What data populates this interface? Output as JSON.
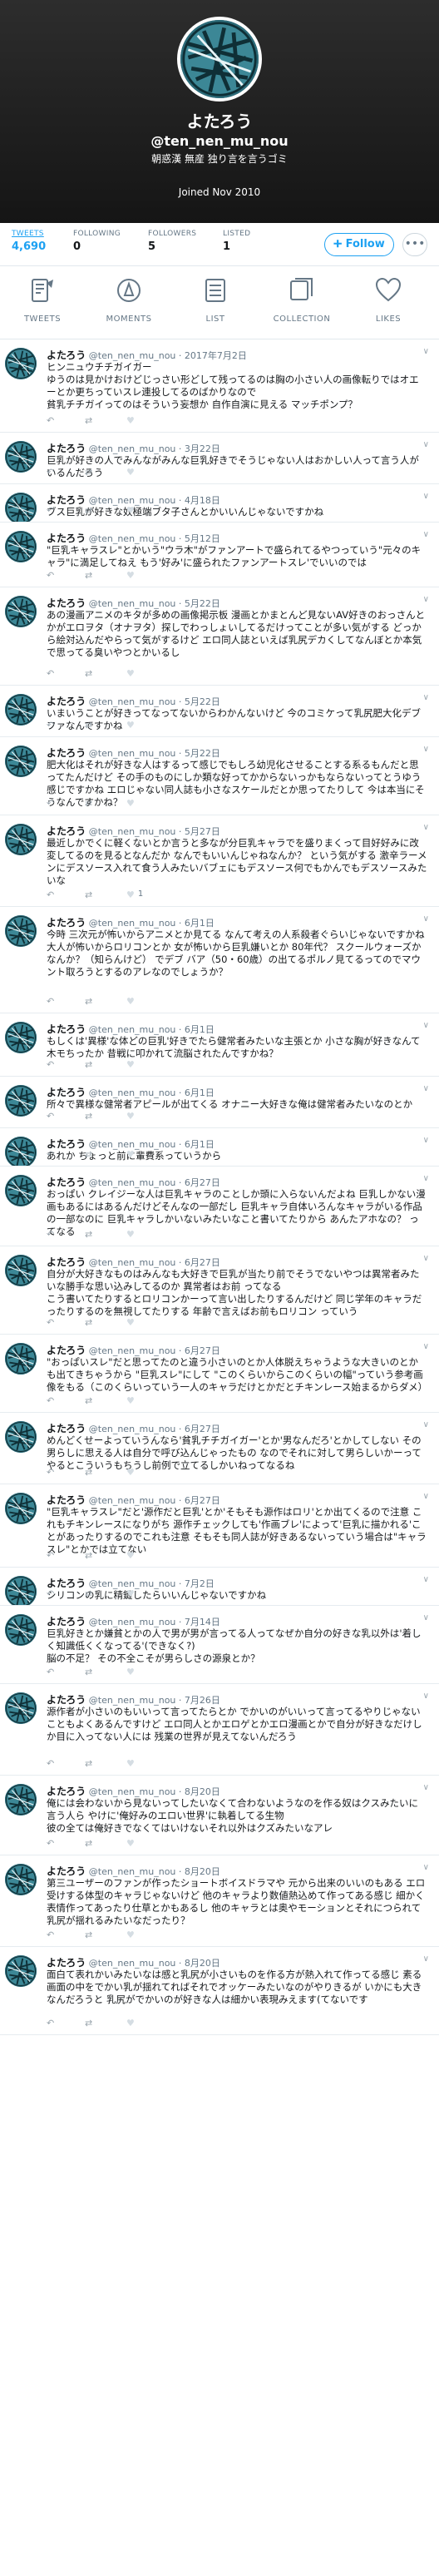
{
  "profile": {
    "name": "よたろう",
    "handle": "@ten_nen_mu_nou",
    "bio": "朝惑漢 無産 独り言を言うゴミ",
    "joined": "Joined Nov 2010",
    "follow_label": "Follow",
    "more_label": "•••"
  },
  "stats": [
    {
      "label": "TWEETS",
      "value": "4,690"
    },
    {
      "label": "FOLLOWING",
      "value": "0"
    },
    {
      "label": "FOLLOWERS",
      "value": "5"
    },
    {
      "label": "LISTED",
      "value": "1"
    }
  ],
  "tabs": [
    {
      "label": "TWEETS",
      "icon": "tweets-icon"
    },
    {
      "label": "MOMENTS",
      "icon": "moments-icon"
    },
    {
      "label": "LIST",
      "icon": "list-icon"
    },
    {
      "label": "COLLECTION",
      "icon": "collection-icon"
    },
    {
      "label": "LIKES",
      "icon": "likes-icon"
    }
  ],
  "tweets": [
    {
      "date": "2017年7月2日",
      "text": "ヒンニュウチチガイガー\nゆうのは見かけおけどじっさい形どして残ってるのは胸の小さい人の画像転りではオエーとか更ちっていスレ連投してるのばかりなので\n貧乳チチガイってのはそういう妄想か 自作自演に見える マッチポンプ？",
      "likes": ""
    },
    {
      "date": "3月22日",
      "text": "巨乳が好きの人でみんながみんな巨乳好きでそうじゃない人はおかしい人って言う人がいるんだろう",
      "likes": ""
    },
    {
      "date": "4月18日",
      "text": "ブス巨乳が好きな奴極端ブタ子さんとかいいんじゃないですかね",
      "likes": ""
    },
    {
      "date": "5月12日",
      "text": "\"巨乳キャラスレ\"とかいう\"ウラ木\"がファンアートで盛られてるやつっていう\"元々のキャラ\"に満足してねえ もう'好み'に盛られたファンアートスレ'でいいのでは",
      "likes": ""
    },
    {
      "date": "5月22日",
      "text": "あの漫画アニメのキタが多めの画像掲示板 漫画とかまとんど見ないAV好きのおっさんとかがエロヲタ（オナヲタ）探しでわっしょいしてるだけってことが多い気がする どっから絵対込んだやらって気がするけど エロ同人誌といえば乳尻デカくしてなんぼとか本気で思ってる臭いやつとかいるし",
      "likes": ""
    },
    {
      "date": "5月22日",
      "text": "いまいうことが好きってなってないからわかんないけど 今のコミケって乳尻肥大化デブファなんですかね",
      "likes": ""
    },
    {
      "date": "5月22日",
      "text": "肥大化はそれが好きな人はするって感じでもしろ幼児化させることする系るもんだと思ってたんだけど その手のものにしか類な好ってかからないっかもならないってとうゆう感じですかね エロじゃない同人誌も小さなスケールだとか思ってたりして 今は本当にそうなんですかね？",
      "likes": ""
    },
    {
      "date": "5月27日",
      "text": "最近しかでくに軽くないとか言うと多なが分巨乳キャラでを盛りまくって目好好みに改変してるのを見るとなんだか なんでもいいんじゃねなんか？ という気がする 激辛ラーメンにデスソース入れて食う人みたいバブェにもデスソース何でもかんでもデスソースみたいな",
      "likes": "1"
    },
    {
      "date": "6月1日",
      "text": "今時 三次元が怖いからアニメとか見てる なんて考えの人系殺者ぐらいじゃないですかね 大人が怖いからロリコンとか 女が怖いから巨乳嫌いとか 80年代？ スクールウォーズかなんか？（知らんけど） でデブ バア（50・60歳）の出てるポルノ見てるってのでマウント取ろうとするのアレなのでしょうか？",
      "likes": ""
    },
    {
      "date": "6月1日",
      "text": "もしくは'異様'な体どの巨乳'好きでたら健常者みたいな主張とか 小さな胸が好きなんて木モちったか 昔戦に叩かれて流脳されたんですかね？",
      "likes": ""
    },
    {
      "date": "6月1日",
      "text": "所々で異様な健常者アピールが出てくる オナニー大好きな俺は健常者みたいなのとか",
      "likes": ""
    },
    {
      "date": "6月1日",
      "text": "あれか ちょっと前に輩費系っていうから",
      "likes": ""
    },
    {
      "date": "6月27日",
      "text": "おっぱい クレイジーな人は巨乳キャラのことしか頭に入らないんだよね 巨乳しかない漫画もあるにはあるんだけどそんなの一部だし 巨乳キャラ自体いろんなキャラがいる作品の一部なのに 巨乳キャラしかいないみたいなこと書いてたりから あんたアホなの？ ってなる",
      "likes": ""
    },
    {
      "date": "6月27日",
      "text": "自分が大好きなものはみんなも大好きで巨乳が当たり前でそうでないやつは異常者みたいな勝手な思い込みしてるのか 異常者はお前 ってなる\nこう書いてたりするとロリコンかーって言い出したりするんだけど 同じ学年のキャラだったりするのを無視してたりする 年齢で言えばお前もロリコン っていう",
      "likes": ""
    },
    {
      "date": "6月27日",
      "text": "\"おっぱいスレ\"だと思ってたのと違う小さいのとか人体脱えちゃうような大きいのとかも出てきちゃうから \"巨乳スレ\"にして \"このくらいからこのくらいの幅\"っていう参考画像をもる（このくらいっていう一人のキャラだけとかだとチキンレース始まるからダメ）",
      "likes": ""
    },
    {
      "date": "6月27日",
      "text": "めんどくせーよっていうんなら'貧乳チチガイガー'とか'男なんだろ'とかしてしない その男らしに思える人は自分で呼び込んじゃったもの なのでそれに対して男らしいかーってやるとこういうもちうし前例で立てるしかいねってなるね",
      "likes": ""
    },
    {
      "date": "6月27日",
      "text": "\"巨乳キャラスレ\"だと'源作だと巨乳'とか'そもそも源作はロリ'とか出てくるので注意 これもチキンレースになりがち 源作チェックしても'作画ブレ'によって'巨乳に描かれる'ことがあったりするのでこれも注意 そもそも同人誌が好きあるないっていう場合は\"キャラスレ\"とかでは立てない",
      "likes": ""
    },
    {
      "date": "7月2日",
      "text": "シリコンの乳に精鍵したらいいんじゃないですかね",
      "likes": ""
    },
    {
      "date": "7月14日",
      "text": "巨乳好きとか嫌貧とかの人で男が男が言ってる人ってなぜか自分の好きな乳以外は'着しく知識低くくなってる'(できなく?)\n脳の不足？ その不全こそが男らしさの源泉とか？",
      "likes": ""
    },
    {
      "date": "7月26日",
      "text": "源作者が小さいのもいいって言ってたらとか でかいのがいいって言ってるやりじゃないこともよくあるんですけど エロ同人とかエロゲとかエロ漫画とかで自分が好きなだけしか目に入ってない人には 残業の世界が見えてないんだろう",
      "likes": ""
    },
    {
      "date": "8月20日",
      "text": "俺には会わないから見ないってしたいなくて合わないようなのを作る奴はクスみたいに言う人ら やけに'俺好みのエロい世界'に執着してる生物\n彼の全ては俺好きでなくてはいけないそれ以外はクズみたいなアレ",
      "likes": ""
    },
    {
      "date": "8月20日",
      "text": "第三ユーザーのファンが作ったショートボイスドラマや 元から出来のいいのもある エロ受けする体型のキャラじゃないけど 他のキャラより数値熱込めて作ってある感じ 細かく表情作ってあったり仕草とかもあるし 他のキャラとは奥やモーションとそれにつられて乳尻が揺れるみたいなだったり？",
      "likes": ""
    },
    {
      "date": "8月20日",
      "text": "面白て表れかいみたいなは感と乳尻が小さいものを作る方が熱入れて作ってる感じ 素る画面の中をでかい乳が揺れてればそれでオッケーみたいなのがやりきるが いかにも大きなんだろうと 乳尻がでかいのが好きな人は細かい表現みえます(てないです",
      "likes": ""
    }
  ],
  "colors": {
    "accent": "#1da1f2",
    "header_bg": "#1f1f1f"
  }
}
